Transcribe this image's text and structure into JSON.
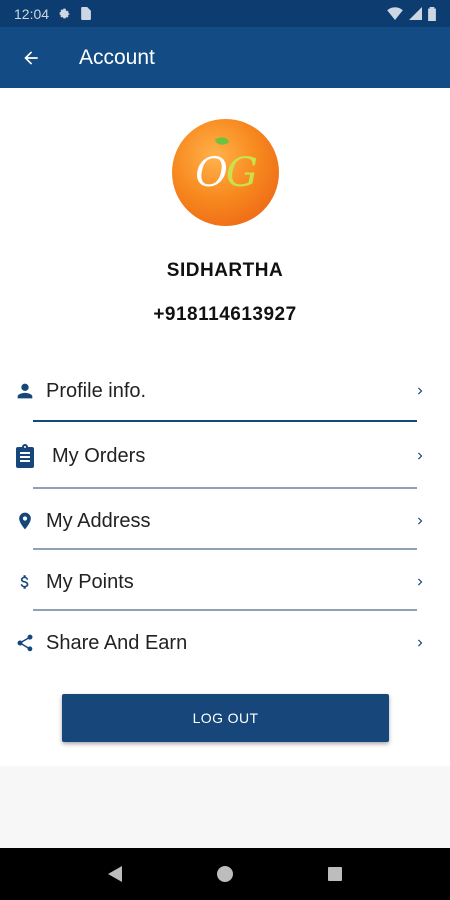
{
  "status_bar": {
    "time": "12:04",
    "icons": [
      "settings-icon",
      "sim-icon",
      "wifi-icon",
      "signal-icon",
      "battery-icon"
    ]
  },
  "app_bar": {
    "title": "Account",
    "back_icon": "arrow-back-icon"
  },
  "profile": {
    "logo_text_o": "O",
    "logo_text_g": "G",
    "name": "SIDHARTHA",
    "phone": "+918114613927"
  },
  "menu": {
    "items": [
      {
        "label": "Profile info.",
        "icon": "person-icon"
      },
      {
        "label": "My Orders",
        "icon": "clipboard-icon"
      },
      {
        "label": "My Address",
        "icon": "location-pin-icon"
      },
      {
        "label": "My Points",
        "icon": "dollar-icon"
      },
      {
        "label": "Share And Earn",
        "icon": "share-icon"
      }
    ]
  },
  "logout_label": "LOG OUT",
  "colors": {
    "primary": "#134b84",
    "status_bar": "#0d3d70",
    "icon": "#17477a"
  },
  "nav_bar": {
    "buttons": [
      "back-triangle-icon",
      "home-circle-icon",
      "recents-square-icon"
    ]
  }
}
